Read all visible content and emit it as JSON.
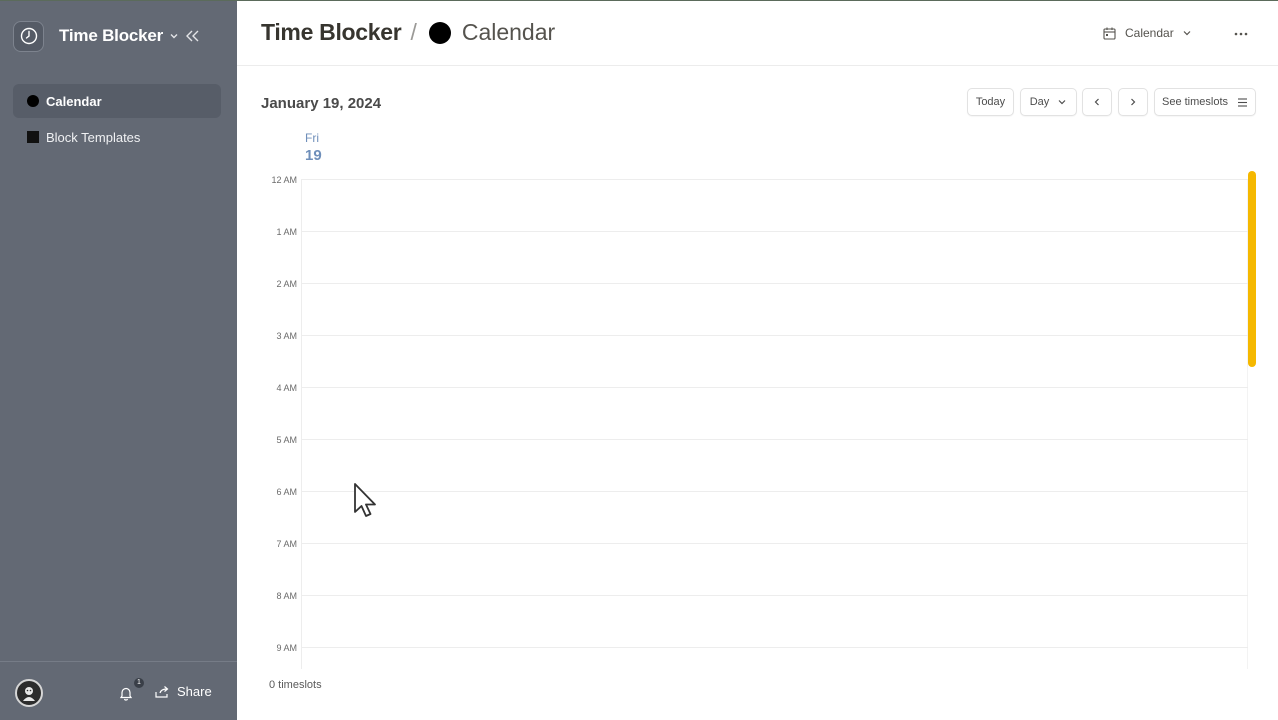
{
  "workspace": {
    "title": "Time Blocker"
  },
  "sidebar": {
    "items": [
      {
        "label": "Calendar",
        "icon": "circle-icon",
        "active": true
      },
      {
        "label": "Block Templates",
        "icon": "square-icon",
        "active": false
      }
    ],
    "footer": {
      "notification_count": "1",
      "share_label": "Share"
    }
  },
  "header": {
    "breadcrumb_root": "Time Blocker",
    "breadcrumb_separator": "/",
    "page_title": "Calendar",
    "view_label": "Calendar"
  },
  "calendar": {
    "date_heading": "January 19, 2024",
    "toolbar": {
      "today_label": "Today",
      "range_label": "Day",
      "see_timeslots_label": "See timeslots"
    },
    "day": {
      "name": "Fri",
      "number": "19"
    },
    "hours": [
      "12 AM",
      "1 AM",
      "2 AM",
      "3 AM",
      "4 AM",
      "5 AM",
      "6 AM",
      "7 AM",
      "8 AM",
      "9 AM"
    ],
    "footer_count": "0 timeslots"
  },
  "colors": {
    "sidebar_bg": "#636974",
    "scrollbar_accent": "#f5b800",
    "day_accent": "#6f8fba"
  }
}
